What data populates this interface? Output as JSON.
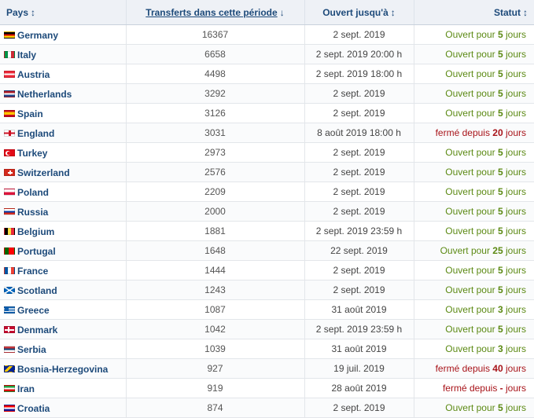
{
  "headers": {
    "country": "Pays",
    "transfers": "Transferts dans cette période",
    "open_until": "Ouvert jusqu'à",
    "status": "Statut",
    "sort_both": "↕",
    "sort_down": "↓"
  },
  "rows": [
    {
      "flag": "de",
      "country": "Germany",
      "transfers": "16367",
      "open_until": "2 sept. 2019",
      "status_prefix": "Ouvert pour ",
      "status_n": "5",
      "status_suffix": " jours",
      "state": "open"
    },
    {
      "flag": "it",
      "country": "Italy",
      "transfers": "6658",
      "open_until": "2 sept. 2019 20:00 h",
      "status_prefix": "Ouvert pour ",
      "status_n": "5",
      "status_suffix": " jours",
      "state": "open"
    },
    {
      "flag": "at",
      "country": "Austria",
      "transfers": "4498",
      "open_until": "2 sept. 2019 18:00 h",
      "status_prefix": "Ouvert pour ",
      "status_n": "5",
      "status_suffix": " jours",
      "state": "open"
    },
    {
      "flag": "nl",
      "country": "Netherlands",
      "transfers": "3292",
      "open_until": "2 sept. 2019",
      "status_prefix": "Ouvert pour ",
      "status_n": "5",
      "status_suffix": " jours",
      "state": "open"
    },
    {
      "flag": "es",
      "country": "Spain",
      "transfers": "3126",
      "open_until": "2 sept. 2019",
      "status_prefix": "Ouvert pour ",
      "status_n": "5",
      "status_suffix": " jours",
      "state": "open"
    },
    {
      "flag": "en",
      "country": "England",
      "transfers": "3031",
      "open_until": "8 août 2019 18:00 h",
      "status_prefix": "fermé depuis ",
      "status_n": "20",
      "status_suffix": " jours",
      "state": "closed"
    },
    {
      "flag": "tr",
      "country": "Turkey",
      "transfers": "2973",
      "open_until": "2 sept. 2019",
      "status_prefix": "Ouvert pour ",
      "status_n": "5",
      "status_suffix": " jours",
      "state": "open"
    },
    {
      "flag": "ch",
      "country": "Switzerland",
      "transfers": "2576",
      "open_until": "2 sept. 2019",
      "status_prefix": "Ouvert pour ",
      "status_n": "5",
      "status_suffix": " jours",
      "state": "open"
    },
    {
      "flag": "pl",
      "country": "Poland",
      "transfers": "2209",
      "open_until": "2 sept. 2019",
      "status_prefix": "Ouvert pour ",
      "status_n": "5",
      "status_suffix": " jours",
      "state": "open"
    },
    {
      "flag": "ru",
      "country": "Russia",
      "transfers": "2000",
      "open_until": "2 sept. 2019",
      "status_prefix": "Ouvert pour ",
      "status_n": "5",
      "status_suffix": " jours",
      "state": "open"
    },
    {
      "flag": "be",
      "country": "Belgium",
      "transfers": "1881",
      "open_until": "2 sept. 2019 23:59 h",
      "status_prefix": "Ouvert pour ",
      "status_n": "5",
      "status_suffix": " jours",
      "state": "open"
    },
    {
      "flag": "pt",
      "country": "Portugal",
      "transfers": "1648",
      "open_until": "22 sept. 2019",
      "status_prefix": "Ouvert pour ",
      "status_n": "25",
      "status_suffix": " jours",
      "state": "open"
    },
    {
      "flag": "fr",
      "country": "France",
      "transfers": "1444",
      "open_until": "2 sept. 2019",
      "status_prefix": "Ouvert pour ",
      "status_n": "5",
      "status_suffix": " jours",
      "state": "open"
    },
    {
      "flag": "sc",
      "country": "Scotland",
      "transfers": "1243",
      "open_until": "2 sept. 2019",
      "status_prefix": "Ouvert pour ",
      "status_n": "5",
      "status_suffix": " jours",
      "state": "open"
    },
    {
      "flag": "gr",
      "country": "Greece",
      "transfers": "1087",
      "open_until": "31 août 2019",
      "status_prefix": "Ouvert pour ",
      "status_n": "3",
      "status_suffix": " jours",
      "state": "open"
    },
    {
      "flag": "dk",
      "country": "Denmark",
      "transfers": "1042",
      "open_until": "2 sept. 2019 23:59 h",
      "status_prefix": "Ouvert pour ",
      "status_n": "5",
      "status_suffix": " jours",
      "state": "open"
    },
    {
      "flag": "rs",
      "country": "Serbia",
      "transfers": "1039",
      "open_until": "31 août 2019",
      "status_prefix": "Ouvert pour ",
      "status_n": "3",
      "status_suffix": " jours",
      "state": "open"
    },
    {
      "flag": "ba",
      "country": "Bosnia-Herzegovina",
      "transfers": "927",
      "open_until": "19 juil. 2019",
      "status_prefix": "fermé depuis ",
      "status_n": "40",
      "status_suffix": " jours",
      "state": "closed"
    },
    {
      "flag": "ir",
      "country": "Iran",
      "transfers": "919",
      "open_until": "28 août 2019",
      "status_prefix": "fermé depuis ",
      "status_n": "-",
      "status_suffix": " jours",
      "state": "closed"
    },
    {
      "flag": "hr",
      "country": "Croatia",
      "transfers": "874",
      "open_until": "2 sept. 2019",
      "status_prefix": "Ouvert pour ",
      "status_n": "5",
      "status_suffix": " jours",
      "state": "open"
    }
  ],
  "colors": {
    "header_bg": "#eef1f6",
    "link": "#1d4a7a",
    "open": "#5c8a14",
    "closed": "#a8141a"
  }
}
